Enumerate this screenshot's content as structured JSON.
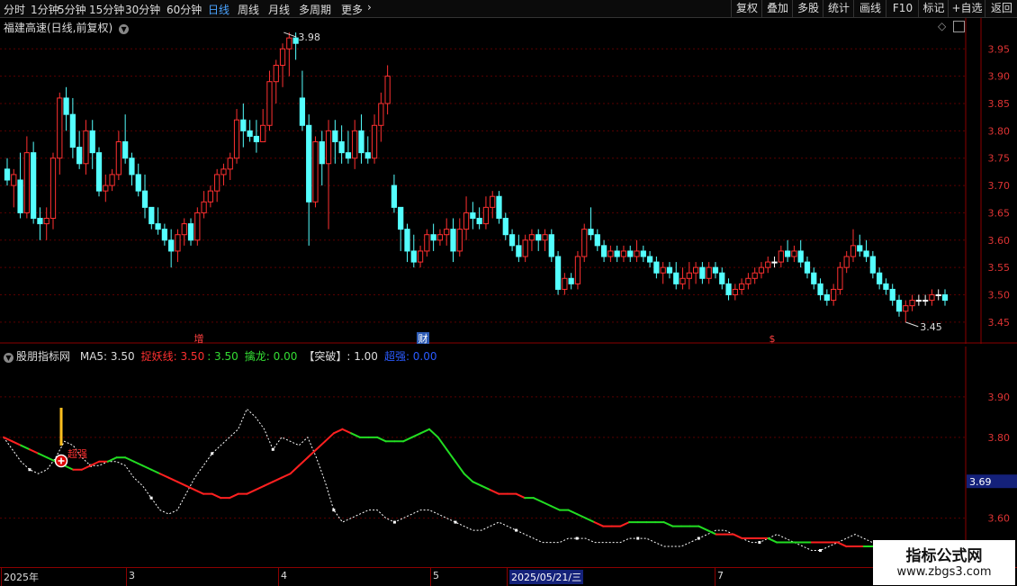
{
  "toolbar": {
    "periods": [
      "分时",
      "1分钟",
      "5分钟",
      "15分钟",
      "30分钟",
      "60分钟",
      "日线",
      "周线",
      "月线",
      "多周期",
      "更多"
    ],
    "active_period": "日线",
    "more_icon": "chevron-right-icon",
    "right_buttons": [
      "复权",
      "叠加",
      "多股",
      "统计",
      "画线",
      "F10",
      "标记",
      "+自选",
      "返回"
    ]
  },
  "main_chart": {
    "title": "福建高速(日线,前复权)",
    "title_icon": "chevron-down-icon",
    "corner_icons": [
      "diamond-icon",
      "panel-toggle-icon"
    ],
    "y_ticks": [
      "3.95",
      "3.90",
      "3.85",
      "3.80",
      "3.75",
      "3.70",
      "3.65",
      "3.60",
      "3.55",
      "3.50",
      "3.45"
    ],
    "ylim": [
      3.43,
      3.99
    ],
    "high_label": "3.98",
    "low_label": "3.45",
    "markers": [
      {
        "text": "增",
        "color": "#ff4040"
      },
      {
        "text": "财",
        "color": "#ffffff",
        "bg": "#2d5bb5"
      },
      {
        "text": "$",
        "color": "#ff4040"
      }
    ],
    "up_color": "#ff3030",
    "down_color": "#54ffff",
    "flat_color": "#ffffff"
  },
  "chart_data": {
    "type": "candlestick",
    "candles": [
      [
        3.73,
        3.75,
        3.7,
        3.71
      ],
      [
        3.7,
        3.73,
        3.66,
        3.72
      ],
      [
        3.71,
        3.76,
        3.64,
        3.65
      ],
      [
        3.65,
        3.79,
        3.64,
        3.76
      ],
      [
        3.76,
        3.78,
        3.63,
        3.64
      ],
      [
        3.64,
        3.66,
        3.6,
        3.63
      ],
      [
        3.63,
        3.66,
        3.6,
        3.64
      ],
      [
        3.64,
        3.76,
        3.62,
        3.75
      ],
      [
        3.75,
        3.87,
        3.72,
        3.86
      ],
      [
        3.86,
        3.88,
        3.8,
        3.83
      ],
      [
        3.83,
        3.86,
        3.75,
        3.77
      ],
      [
        3.77,
        3.8,
        3.73,
        3.74
      ],
      [
        3.74,
        3.82,
        3.72,
        3.8
      ],
      [
        3.8,
        3.82,
        3.73,
        3.76
      ],
      [
        3.76,
        3.77,
        3.68,
        3.69
      ],
      [
        3.69,
        3.72,
        3.67,
        3.7
      ],
      [
        3.7,
        3.73,
        3.69,
        3.72
      ],
      [
        3.72,
        3.8,
        3.71,
        3.78
      ],
      [
        3.78,
        3.83,
        3.74,
        3.75
      ],
      [
        3.75,
        3.76,
        3.7,
        3.72
      ],
      [
        3.72,
        3.74,
        3.68,
        3.69
      ],
      [
        3.69,
        3.72,
        3.64,
        3.66
      ],
      [
        3.66,
        3.66,
        3.62,
        3.63
      ],
      [
        3.63,
        3.66,
        3.61,
        3.62
      ],
      [
        3.62,
        3.63,
        3.59,
        3.6
      ],
      [
        3.6,
        3.62,
        3.55,
        3.58
      ],
      [
        3.58,
        3.62,
        3.56,
        3.61
      ],
      [
        3.61,
        3.64,
        3.59,
        3.63
      ],
      [
        3.63,
        3.64,
        3.59,
        3.6
      ],
      [
        3.6,
        3.66,
        3.59,
        3.65
      ],
      [
        3.65,
        3.69,
        3.64,
        3.67
      ],
      [
        3.67,
        3.7,
        3.66,
        3.69
      ],
      [
        3.69,
        3.73,
        3.67,
        3.72
      ],
      [
        3.72,
        3.74,
        3.7,
        3.73
      ],
      [
        3.73,
        3.76,
        3.71,
        3.75
      ],
      [
        3.75,
        3.84,
        3.74,
        3.82
      ],
      [
        3.82,
        3.85,
        3.77,
        3.8
      ],
      [
        3.8,
        3.82,
        3.78,
        3.79
      ],
      [
        3.79,
        3.82,
        3.76,
        3.78
      ],
      [
        3.78,
        3.84,
        3.78,
        3.81
      ],
      [
        3.81,
        3.91,
        3.8,
        3.89
      ],
      [
        3.89,
        3.93,
        3.85,
        3.92
      ],
      [
        3.92,
        3.96,
        3.88,
        3.95
      ],
      [
        3.95,
        3.98,
        3.9,
        3.97
      ],
      [
        3.97,
        3.98,
        3.93,
        3.96
      ],
      [
        3.86,
        3.91,
        3.8,
        3.81
      ],
      [
        3.81,
        3.83,
        3.59,
        3.67
      ],
      [
        3.67,
        3.79,
        3.66,
        3.78
      ],
      [
        3.78,
        3.8,
        3.7,
        3.74
      ],
      [
        3.74,
        3.82,
        3.62,
        3.8
      ],
      [
        3.8,
        3.82,
        3.74,
        3.78
      ],
      [
        3.78,
        3.81,
        3.74,
        3.76
      ],
      [
        3.76,
        3.8,
        3.74,
        3.75
      ],
      [
        3.75,
        3.82,
        3.73,
        3.8
      ],
      [
        3.8,
        3.83,
        3.74,
        3.76
      ],
      [
        3.76,
        3.79,
        3.74,
        3.75
      ],
      [
        3.75,
        3.83,
        3.74,
        3.81
      ],
      [
        3.81,
        3.87,
        3.78,
        3.85
      ],
      [
        3.85,
        3.92,
        3.83,
        3.9
      ],
      [
        3.7,
        3.72,
        3.65,
        3.66
      ],
      [
        3.66,
        3.66,
        3.58,
        3.62
      ],
      [
        3.62,
        3.63,
        3.56,
        3.58
      ],
      [
        3.58,
        3.61,
        3.55,
        3.56
      ],
      [
        3.56,
        3.59,
        3.55,
        3.58
      ],
      [
        3.58,
        3.62,
        3.57,
        3.61
      ],
      [
        3.61,
        3.63,
        3.58,
        3.6
      ],
      [
        3.6,
        3.62,
        3.59,
        3.61
      ],
      [
        3.61,
        3.64,
        3.59,
        3.62
      ],
      [
        3.62,
        3.64,
        3.56,
        3.58
      ],
      [
        3.58,
        3.64,
        3.57,
        3.62
      ],
      [
        3.62,
        3.68,
        3.6,
        3.65
      ],
      [
        3.65,
        3.67,
        3.62,
        3.64
      ],
      [
        3.64,
        3.66,
        3.62,
        3.63
      ],
      [
        3.63,
        3.68,
        3.62,
        3.66
      ],
      [
        3.66,
        3.69,
        3.64,
        3.68
      ],
      [
        3.68,
        3.69,
        3.63,
        3.64
      ],
      [
        3.64,
        3.65,
        3.6,
        3.61
      ],
      [
        3.61,
        3.62,
        3.58,
        3.59
      ],
      [
        3.59,
        3.61,
        3.56,
        3.57
      ],
      [
        3.57,
        3.61,
        3.56,
        3.6
      ],
      [
        3.6,
        3.62,
        3.58,
        3.61
      ],
      [
        3.61,
        3.62,
        3.58,
        3.6
      ],
      [
        3.6,
        3.62,
        3.58,
        3.61
      ],
      [
        3.61,
        3.62,
        3.56,
        3.57
      ],
      [
        3.57,
        3.58,
        3.5,
        3.51
      ],
      [
        3.51,
        3.54,
        3.5,
        3.53
      ],
      [
        3.53,
        3.54,
        3.51,
        3.52
      ],
      [
        3.52,
        3.58,
        3.51,
        3.57
      ],
      [
        3.57,
        3.63,
        3.56,
        3.62
      ],
      [
        3.62,
        3.66,
        3.6,
        3.61
      ],
      [
        3.61,
        3.62,
        3.58,
        3.59
      ],
      [
        3.59,
        3.6,
        3.56,
        3.57
      ],
      [
        3.57,
        3.59,
        3.56,
        3.58
      ],
      [
        3.58,
        3.59,
        3.56,
        3.57
      ],
      [
        3.57,
        3.59,
        3.56,
        3.58
      ],
      [
        3.58,
        3.59,
        3.56,
        3.57
      ],
      [
        3.57,
        3.6,
        3.56,
        3.58
      ],
      [
        3.58,
        3.59,
        3.56,
        3.57
      ],
      [
        3.57,
        3.58,
        3.55,
        3.56
      ],
      [
        3.56,
        3.57,
        3.53,
        3.54
      ],
      [
        3.54,
        3.56,
        3.52,
        3.55
      ],
      [
        3.55,
        3.56,
        3.53,
        3.54
      ],
      [
        3.54,
        3.56,
        3.51,
        3.52
      ],
      [
        3.52,
        3.55,
        3.51,
        3.53
      ],
      [
        3.53,
        3.56,
        3.51,
        3.54
      ],
      [
        3.54,
        3.56,
        3.52,
        3.55
      ],
      [
        3.55,
        3.56,
        3.52,
        3.53
      ],
      [
        3.53,
        3.56,
        3.52,
        3.55
      ],
      [
        3.55,
        3.56,
        3.53,
        3.54
      ],
      [
        3.54,
        3.55,
        3.51,
        3.52
      ],
      [
        3.52,
        3.53,
        3.49,
        3.5
      ],
      [
        3.5,
        3.52,
        3.49,
        3.51
      ],
      [
        3.51,
        3.53,
        3.5,
        3.52
      ],
      [
        3.52,
        3.54,
        3.51,
        3.53
      ],
      [
        3.53,
        3.55,
        3.52,
        3.54
      ],
      [
        3.54,
        3.56,
        3.53,
        3.55
      ],
      [
        3.55,
        3.57,
        3.54,
        3.56
      ],
      [
        3.56,
        3.57,
        3.55,
        3.56
      ],
      [
        3.56,
        3.59,
        3.55,
        3.58
      ],
      [
        3.58,
        3.6,
        3.56,
        3.57
      ],
      [
        3.57,
        3.59,
        3.56,
        3.58
      ],
      [
        3.58,
        3.6,
        3.55,
        3.56
      ],
      [
        3.56,
        3.57,
        3.53,
        3.54
      ],
      [
        3.54,
        3.55,
        3.51,
        3.52
      ],
      [
        3.52,
        3.53,
        3.49,
        3.5
      ],
      [
        3.5,
        3.51,
        3.48,
        3.49
      ],
      [
        3.49,
        3.52,
        3.48,
        3.51
      ],
      [
        3.51,
        3.56,
        3.5,
        3.55
      ],
      [
        3.55,
        3.58,
        3.54,
        3.57
      ],
      [
        3.57,
        3.62,
        3.56,
        3.59
      ],
      [
        3.59,
        3.61,
        3.57,
        3.58
      ],
      [
        3.58,
        3.6,
        3.56,
        3.57
      ],
      [
        3.57,
        3.58,
        3.53,
        3.54
      ],
      [
        3.54,
        3.55,
        3.51,
        3.52
      ],
      [
        3.52,
        3.53,
        3.5,
        3.51
      ],
      [
        3.51,
        3.52,
        3.48,
        3.49
      ],
      [
        3.49,
        3.5,
        3.46,
        3.47
      ],
      [
        3.47,
        3.49,
        3.45,
        3.48
      ],
      [
        3.48,
        3.5,
        3.47,
        3.49
      ],
      [
        3.49,
        3.5,
        3.48,
        3.49
      ],
      [
        3.49,
        3.5,
        3.48,
        3.49
      ],
      [
        3.49,
        3.51,
        3.48,
        3.5
      ],
      [
        3.5,
        3.51,
        3.49,
        3.5
      ],
      [
        3.5,
        3.51,
        3.48,
        3.49
      ]
    ],
    "indicator": {
      "ylim": [
        3.49,
        3.98
      ],
      "y_ticks": [
        "3.90",
        "3.80",
        "3.60"
      ],
      "current_value": "3.69",
      "ma_line": [
        3.8,
        3.79,
        3.78,
        3.77,
        3.76,
        3.75,
        3.74,
        3.73,
        3.72,
        3.72,
        3.73,
        3.74,
        3.74,
        3.75,
        3.75,
        3.74,
        3.73,
        3.72,
        3.71,
        3.7,
        3.69,
        3.68,
        3.67,
        3.66,
        3.66,
        3.65,
        3.65,
        3.66,
        3.66,
        3.67,
        3.68,
        3.69,
        3.7,
        3.71,
        3.73,
        3.75,
        3.77,
        3.79,
        3.81,
        3.82,
        3.81,
        3.8,
        3.8,
        3.8,
        3.79,
        3.79,
        3.79,
        3.8,
        3.81,
        3.82,
        3.8,
        3.77,
        3.74,
        3.71,
        3.69,
        3.68,
        3.67,
        3.66,
        3.66,
        3.66,
        3.65,
        3.65,
        3.64,
        3.63,
        3.62,
        3.62,
        3.61,
        3.6,
        3.59,
        3.58,
        3.58,
        3.58,
        3.59,
        3.59,
        3.59,
        3.59,
        3.59,
        3.58,
        3.58,
        3.58,
        3.58,
        3.57,
        3.56,
        3.56,
        3.56,
        3.55,
        3.55,
        3.55,
        3.55,
        3.54,
        3.54,
        3.54,
        3.54,
        3.54,
        3.54,
        3.54,
        3.54,
        3.53,
        3.53,
        3.53,
        3.53,
        3.53,
        3.53,
        3.52,
        3.52
      ],
      "ma_trend": "rrgrggggrrrrggggggrrrrrrrrrrrrrrrrrrrrrrggggggggggggggggrrrrggggggggrrrrggggggggggrrrrrrgggggrrrrrrgggggggggg",
      "dotted_line": [
        3.8,
        3.77,
        3.74,
        3.72,
        3.71,
        3.72,
        3.75,
        3.79,
        3.78,
        3.75,
        3.73,
        3.73,
        3.74,
        3.74,
        3.73,
        3.7,
        3.68,
        3.65,
        3.62,
        3.61,
        3.62,
        3.66,
        3.7,
        3.73,
        3.76,
        3.78,
        3.8,
        3.82,
        3.87,
        3.85,
        3.82,
        3.77,
        3.8,
        3.79,
        3.78,
        3.8,
        3.75,
        3.69,
        3.62,
        3.59,
        3.6,
        3.61,
        3.62,
        3.62,
        3.6,
        3.59,
        3.6,
        3.61,
        3.62,
        3.62,
        3.61,
        3.6,
        3.59,
        3.58,
        3.57,
        3.57,
        3.58,
        3.59,
        3.58,
        3.57,
        3.56,
        3.55,
        3.54,
        3.54,
        3.54,
        3.55,
        3.55,
        3.55,
        3.54,
        3.54,
        3.54,
        3.54,
        3.55,
        3.55,
        3.55,
        3.54,
        3.53,
        3.53,
        3.53,
        3.54,
        3.55,
        3.56,
        3.57,
        3.57,
        3.56,
        3.55,
        3.54,
        3.54,
        3.55,
        3.56,
        3.55,
        3.54,
        3.53,
        3.52,
        3.52,
        3.53,
        3.54,
        3.55,
        3.56,
        3.55,
        3.54,
        3.53,
        3.52,
        3.52,
        3.51
      ]
    }
  },
  "indicator_header": {
    "name": "股朋指标网",
    "items": [
      {
        "text": "MA5: 3.50",
        "color": "#dddddd"
      },
      {
        "text": "捉妖线: 3.50",
        "color": "#ff3030"
      },
      {
        "text": ": 3.50",
        "color": "#33dd33"
      },
      {
        "text": "擒龙: 0.00",
        "color": "#33dd33"
      },
      {
        "text": "【突破】: 1.00",
        "color": "#dddddd"
      },
      {
        "text": "超强: 0.00",
        "color": "#2a5bff"
      }
    ],
    "signal_text": "超强",
    "signal_icon": "plus-circle-icon"
  },
  "date_axis": [
    "2025年",
    "3",
    "4",
    "5",
    "2025/05/21/三",
    "7"
  ],
  "watermark": {
    "title": "指标公式网",
    "url": "www.zbgs3.com"
  }
}
